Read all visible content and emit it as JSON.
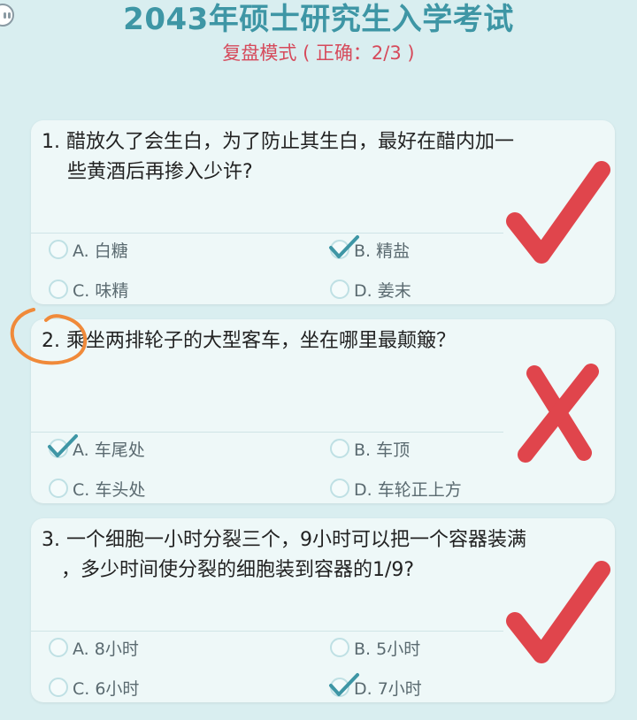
{
  "header": {
    "title": "2043年硕士研究生入学考试",
    "subtitle": "复盘模式 ( 正确：2/3 )"
  },
  "questions": [
    {
      "text": "1. 醋放久了会生白，为了防止其生白，最好在醋内加一　　些黄酒后再掺入少许?",
      "line1": "1. 醋放久了会生白，为了防止其生白，最好在醋内加一",
      "line2": "　 些黄酒后再掺入少许?",
      "result": "correct",
      "options": [
        {
          "label": "A. 白糖",
          "checked": false
        },
        {
          "label": "B. 精盐",
          "checked": true
        },
        {
          "label": "C. 味精",
          "checked": false
        },
        {
          "label": "D. 姜末",
          "checked": false
        }
      ]
    },
    {
      "line1": "2. 乘坐两排轮子的大型客车，坐在哪里最颠簸？",
      "line2": "",
      "result": "wrong",
      "options": [
        {
          "label": "A. 车尾处",
          "checked": true
        },
        {
          "label": "B. 车顶",
          "checked": false
        },
        {
          "label": "C. 车头处",
          "checked": false
        },
        {
          "label": "D. 车轮正上方",
          "checked": false
        }
      ]
    },
    {
      "line1": "3. 一个细胞一小时分裂三个，9小时可以把一个容器装满",
      "line2": "　，多少时间使分裂的细胞装到容器的1/9?",
      "result": "correct",
      "options": [
        {
          "label": "A. 8小时",
          "checked": false
        },
        {
          "label": "B. 5小时",
          "checked": false
        },
        {
          "label": "C. 6小时",
          "checked": false
        },
        {
          "label": "D. 7小时",
          "checked": true
        }
      ]
    }
  ],
  "colors": {
    "correct_mark": "#e0454c",
    "wrong_mark": "#e0454c",
    "checkmark": "#3e96a5",
    "annotation": "#f08a3a"
  }
}
